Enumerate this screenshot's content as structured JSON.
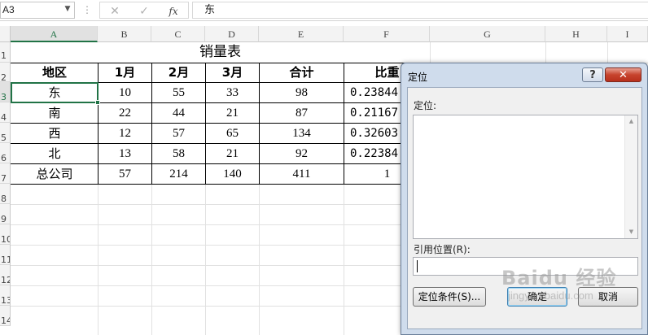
{
  "formula_bar": {
    "name_box": "A3",
    "cancel_icon": "✕",
    "enter_icon": "✓",
    "function_icon": "fx",
    "content": "东"
  },
  "sheet": {
    "columns": [
      "A",
      "B",
      "C",
      "D",
      "E",
      "F",
      "G",
      "H",
      "I"
    ],
    "rows": [
      "1",
      "2",
      "3",
      "4",
      "5",
      "6",
      "7",
      "8",
      "9",
      "10",
      "11",
      "12",
      "13",
      "14"
    ],
    "active_column": "A",
    "active_row": "3",
    "title": "销量表",
    "headers": [
      "地区",
      "1月",
      "2月",
      "3月",
      "合计",
      "比重"
    ],
    "data": [
      [
        "东",
        "10",
        "55",
        "33",
        "98",
        "0.23844"
      ],
      [
        "南",
        "22",
        "44",
        "21",
        "87",
        "0.21167"
      ],
      [
        "西",
        "12",
        "57",
        "65",
        "134",
        "0.32603"
      ],
      [
        "北",
        "13",
        "58",
        "21",
        "92",
        "0.22384"
      ],
      [
        "总公司",
        "57",
        "214",
        "140",
        "411",
        "1"
      ]
    ],
    "accent_color": "#217346"
  },
  "dialog": {
    "title": "定位",
    "help_label": "?",
    "close_label": "✕",
    "goto_label": "定位:",
    "reference_label": "引用位置(R):",
    "reference_value": "",
    "special_button": "定位条件(S)...",
    "ok_button": "确定",
    "cancel_button": "取消"
  },
  "watermark": {
    "text": "Baidu 经验",
    "url": "jingyan.baidu.com"
  }
}
